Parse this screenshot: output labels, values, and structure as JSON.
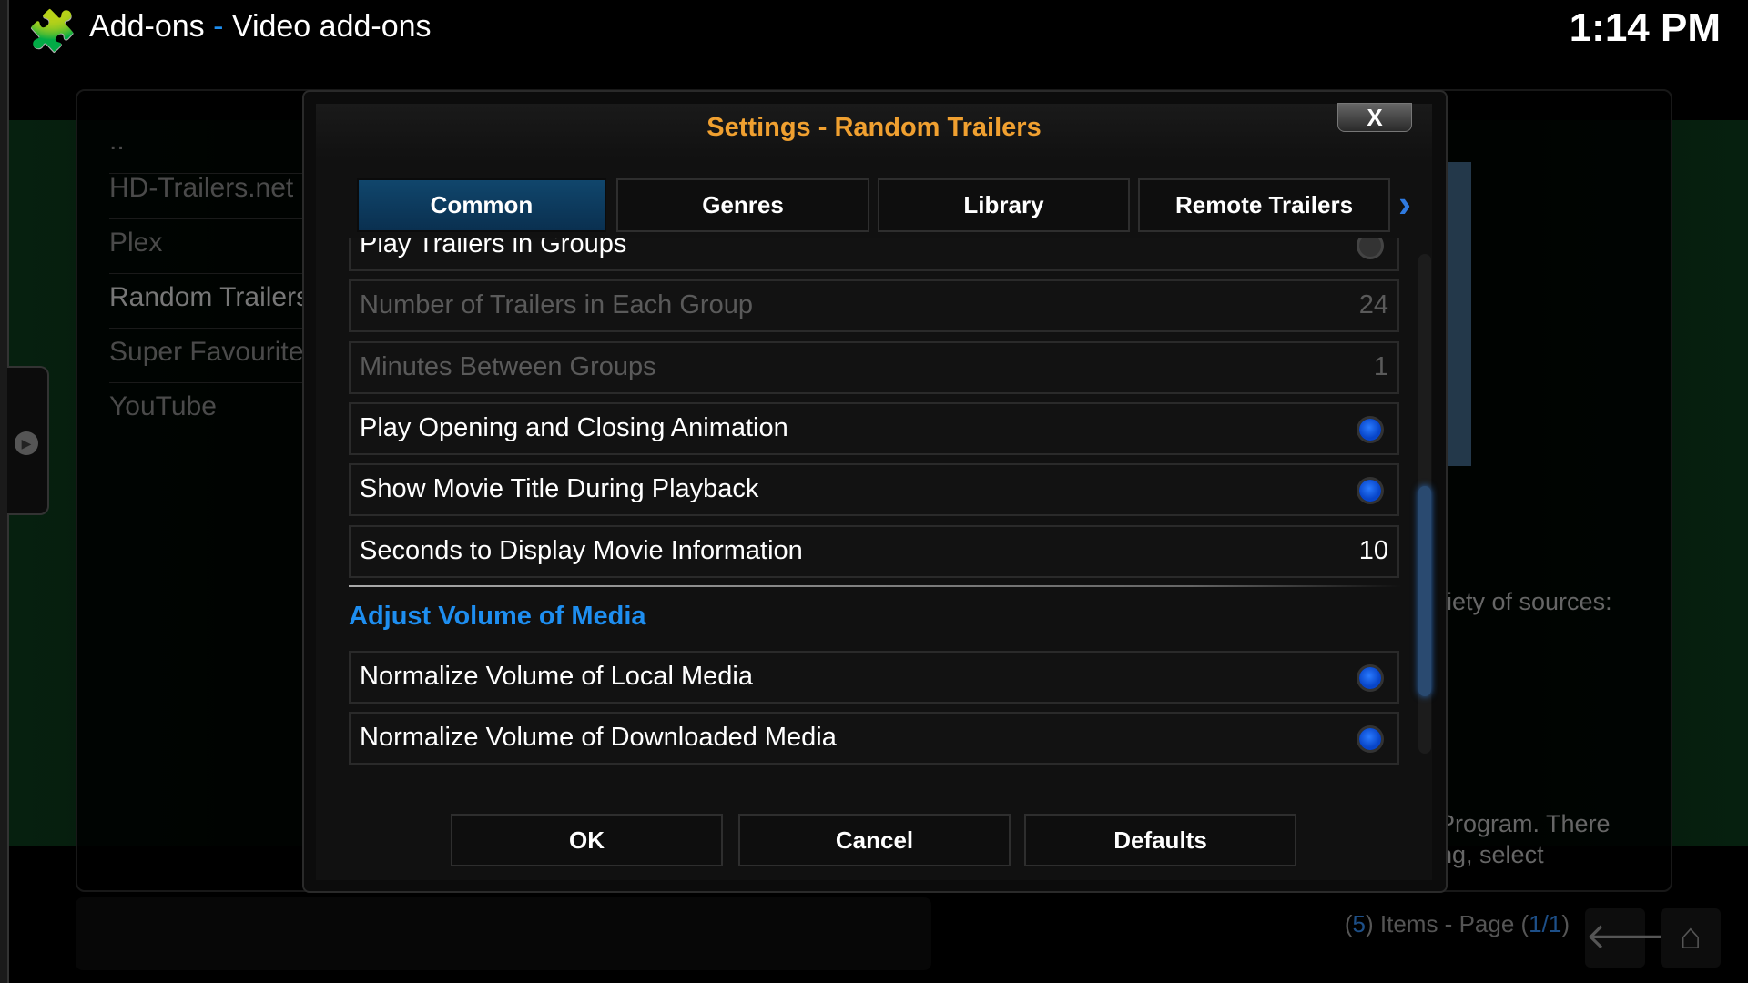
{
  "header": {
    "icon": "puzzle-piece-icon",
    "section": "Add-ons",
    "separator": "-",
    "subsection": "Video add-ons",
    "clock": "1:14 PM"
  },
  "background_list": {
    "items": [
      "..",
      "HD-Trailers.net",
      "Plex",
      "Random Trailers",
      "Super Favourites",
      "YouTube"
    ]
  },
  "background_text": {
    "line1": "riety of sources:",
    "line2": "Program. There",
    "line3": "ng, select"
  },
  "footer": {
    "items_prefix": "(",
    "items_count": "5",
    "items_mid": ") Items - Page (",
    "page": "1/1",
    "items_suffix": ")",
    "back_icon": "back-arrow-icon",
    "home_icon": "home-icon"
  },
  "dialog": {
    "title": "Settings - Random Trailers",
    "close_label": "X",
    "tabs": [
      {
        "label": "Common",
        "active": true
      },
      {
        "label": "Genres"
      },
      {
        "label": "Library"
      },
      {
        "label": "Remote Trailers"
      }
    ],
    "next_tab_icon": "chevron-right-icon",
    "settings": [
      {
        "label": "Play Trailers in Groups",
        "type": "toggle",
        "value": false
      },
      {
        "label": "Number of Trailers in Each Group",
        "type": "number",
        "value": "24",
        "disabled": true
      },
      {
        "label": "Minutes Between Groups",
        "type": "number",
        "value": "1",
        "disabled": true
      },
      {
        "label": "Play Opening and Closing Animation",
        "type": "toggle",
        "value": true
      },
      {
        "label": "Show Movie Title During Playback",
        "type": "toggle",
        "value": true
      },
      {
        "label": "Seconds to Display Movie Information",
        "type": "number",
        "value": "10"
      }
    ],
    "section_heading": "Adjust Volume of Media",
    "section_settings": [
      {
        "label": "Normalize Volume of Local Media",
        "type": "toggle",
        "value": true
      },
      {
        "label": "Normalize Volume of Downloaded Media",
        "type": "toggle",
        "value": true
      }
    ],
    "buttons": {
      "ok": "OK",
      "cancel": "Cancel",
      "defaults": "Defaults"
    },
    "accent_color": "#1e8ef0",
    "title_color": "#f0a030"
  }
}
